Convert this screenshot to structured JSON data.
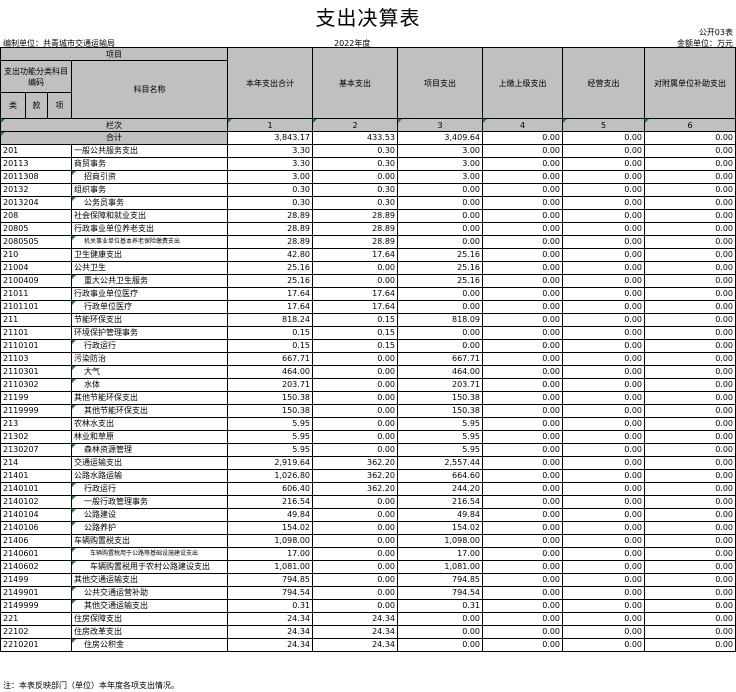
{
  "title": "支出决算表",
  "form_no": "公开03表",
  "org_unit": "编制单位：共青城市交通运输局",
  "year": "2022年度",
  "money_unit": "金额单位：万元",
  "headers": {
    "project": "项目",
    "func_class": "支出功能分类科目编码",
    "subject_name": "科目名称",
    "total": "本年支出合计",
    "basic": "基本支出",
    "project_exp": "项目支出",
    "upper_pay": "上缴上级支出",
    "operation": "经营支出",
    "subsidy": "对附属单位补助支出",
    "lei": "类",
    "kuan": "款",
    "xiang": "项",
    "col_label": "栏次",
    "col_nums": [
      "1",
      "2",
      "3",
      "4",
      "5",
      "6"
    ]
  },
  "total_row": {
    "label": "合计",
    "values": [
      "3,843.17",
      "433.53",
      "3,409.64",
      "0.00",
      "0.00",
      "0.00"
    ]
  },
  "rows": [
    {
      "code": "201",
      "name": "一般公共服务支出",
      "level": 0,
      "values": [
        "3.30",
        "0.30",
        "3.00",
        "0.00",
        "0.00",
        "0.00"
      ]
    },
    {
      "code": "20113",
      "name": "商贸事务",
      "level": 0,
      "values": [
        "3.30",
        "0.30",
        "3.00",
        "0.00",
        "0.00",
        "0.00"
      ]
    },
    {
      "code": "2011308",
      "name": "招商引资",
      "level": 1,
      "values": [
        "3.00",
        "0.00",
        "3.00",
        "0.00",
        "0.00",
        "0.00"
      ]
    },
    {
      "code": "20132",
      "name": "组织事务",
      "level": 0,
      "values": [
        "0.30",
        "0.30",
        "0.00",
        "0.00",
        "0.00",
        "0.00"
      ]
    },
    {
      "code": "2013204",
      "name": "公务员事务",
      "level": 1,
      "values": [
        "0.30",
        "0.30",
        "0.00",
        "0.00",
        "0.00",
        "0.00"
      ]
    },
    {
      "code": "208",
      "name": "社会保障和就业支出",
      "level": 0,
      "values": [
        "28.89",
        "28.89",
        "0.00",
        "0.00",
        "0.00",
        "0.00"
      ]
    },
    {
      "code": "20805",
      "name": "行政事业单位养老支出",
      "level": 0,
      "values": [
        "28.89",
        "28.89",
        "0.00",
        "0.00",
        "0.00",
        "0.00"
      ]
    },
    {
      "code": "2080505",
      "name": "机关事业单位基本养老保险缴费支出",
      "level": 1,
      "small": true,
      "values": [
        "28.89",
        "28.89",
        "0.00",
        "0.00",
        "0.00",
        "0.00"
      ]
    },
    {
      "code": "210",
      "name": "卫生健康支出",
      "level": 0,
      "values": [
        "42.80",
        "17.64",
        "25.16",
        "0.00",
        "0.00",
        "0.00"
      ]
    },
    {
      "code": "21004",
      "name": "公共卫生",
      "level": 0,
      "values": [
        "25.16",
        "0.00",
        "25.16",
        "0.00",
        "0.00",
        "0.00"
      ]
    },
    {
      "code": "2100409",
      "name": "重大公共卫生服务",
      "level": 1,
      "values": [
        "25.16",
        "0.00",
        "25.16",
        "0.00",
        "0.00",
        "0.00"
      ]
    },
    {
      "code": "21011",
      "name": "行政事业单位医疗",
      "level": 0,
      "values": [
        "17.64",
        "17.64",
        "0.00",
        "0.00",
        "0.00",
        "0.00"
      ]
    },
    {
      "code": "2101101",
      "name": "行政单位医疗",
      "level": 1,
      "values": [
        "17.64",
        "17.64",
        "0.00",
        "0.00",
        "0.00",
        "0.00"
      ]
    },
    {
      "code": "211",
      "name": "节能环保支出",
      "level": 0,
      "values": [
        "818.24",
        "0.15",
        "818.09",
        "0.00",
        "0.00",
        "0.00"
      ]
    },
    {
      "code": "21101",
      "name": "环境保护管理事务",
      "level": 0,
      "values": [
        "0.15",
        "0.15",
        "0.00",
        "0.00",
        "0.00",
        "0.00"
      ]
    },
    {
      "code": "2110101",
      "name": "行政运行",
      "level": 1,
      "values": [
        "0.15",
        "0.15",
        "0.00",
        "0.00",
        "0.00",
        "0.00"
      ]
    },
    {
      "code": "21103",
      "name": "污染防治",
      "level": 0,
      "values": [
        "667.71",
        "0.00",
        "667.71",
        "0.00",
        "0.00",
        "0.00"
      ]
    },
    {
      "code": "2110301",
      "name": "大气",
      "level": 1,
      "values": [
        "464.00",
        "0.00",
        "464.00",
        "0.00",
        "0.00",
        "0.00"
      ]
    },
    {
      "code": "2110302",
      "name": "水体",
      "level": 1,
      "values": [
        "203.71",
        "0.00",
        "203.71",
        "0.00",
        "0.00",
        "0.00"
      ]
    },
    {
      "code": "21199",
      "name": "其他节能环保支出",
      "level": 0,
      "values": [
        "150.38",
        "0.00",
        "150.38",
        "0.00",
        "0.00",
        "0.00"
      ]
    },
    {
      "code": "2119999",
      "name": "其他节能环保支出",
      "level": 1,
      "values": [
        "150.38",
        "0.00",
        "150.38",
        "0.00",
        "0.00",
        "0.00"
      ]
    },
    {
      "code": "213",
      "name": "农林水支出",
      "level": 0,
      "values": [
        "5.95",
        "0.00",
        "5.95",
        "0.00",
        "0.00",
        "0.00"
      ]
    },
    {
      "code": "21302",
      "name": "林业和草原",
      "level": 0,
      "values": [
        "5.95",
        "0.00",
        "5.95",
        "0.00",
        "0.00",
        "0.00"
      ]
    },
    {
      "code": "2130207",
      "name": "森林资源管理",
      "level": 1,
      "values": [
        "5.95",
        "0.00",
        "5.95",
        "0.00",
        "0.00",
        "0.00"
      ]
    },
    {
      "code": "214",
      "name": "交通运输支出",
      "level": 0,
      "values": [
        "2,919.64",
        "362.20",
        "2,557.44",
        "0.00",
        "0.00",
        "0.00"
      ]
    },
    {
      "code": "21401",
      "name": "公路水路运输",
      "level": 0,
      "values": [
        "1,026.80",
        "362.20",
        "664.60",
        "0.00",
        "0.00",
        "0.00"
      ]
    },
    {
      "code": "2140101",
      "name": "行政运行",
      "level": 1,
      "values": [
        "606.40",
        "362.20",
        "244.20",
        "0.00",
        "0.00",
        "0.00"
      ]
    },
    {
      "code": "2140102",
      "name": "一般行政管理事务",
      "level": 1,
      "values": [
        "216.54",
        "0.00",
        "216.54",
        "0.00",
        "0.00",
        "0.00"
      ]
    },
    {
      "code": "2140104",
      "name": "公路建设",
      "level": 1,
      "values": [
        "49.84",
        "0.00",
        "49.84",
        "0.00",
        "0.00",
        "0.00"
      ]
    },
    {
      "code": "2140106",
      "name": "公路养护",
      "level": 1,
      "values": [
        "154.02",
        "0.00",
        "154.02",
        "0.00",
        "0.00",
        "0.00"
      ]
    },
    {
      "code": "21406",
      "name": "车辆购置税支出",
      "level": 0,
      "values": [
        "1,098.00",
        "0.00",
        "1,098.00",
        "0.00",
        "0.00",
        "0.00"
      ]
    },
    {
      "code": "2140601",
      "name": "车辆购置税用于公路等基础设施建设支出",
      "level": 2,
      "small": true,
      "values": [
        "17.00",
        "0.00",
        "17.00",
        "0.00",
        "0.00",
        "0.00"
      ]
    },
    {
      "code": "2140602",
      "name": "车辆购置税用于农村公路建设支出",
      "level": 2,
      "values": [
        "1,081.00",
        "0.00",
        "1,081.00",
        "0.00",
        "0.00",
        "0.00"
      ]
    },
    {
      "code": "21499",
      "name": "其他交通运输支出",
      "level": 0,
      "values": [
        "794.85",
        "0.00",
        "794.85",
        "0.00",
        "0.00",
        "0.00"
      ]
    },
    {
      "code": "2149901",
      "name": "公共交通运营补助",
      "level": 1,
      "values": [
        "794.54",
        "0.00",
        "794.54",
        "0.00",
        "0.00",
        "0.00"
      ]
    },
    {
      "code": "2149999",
      "name": "其他交通运输支出",
      "level": 1,
      "values": [
        "0.31",
        "0.00",
        "0.31",
        "0.00",
        "0.00",
        "0.00"
      ]
    },
    {
      "code": "221",
      "name": "住房保障支出",
      "level": 0,
      "values": [
        "24.34",
        "24.34",
        "0.00",
        "0.00",
        "0.00",
        "0.00"
      ]
    },
    {
      "code": "22102",
      "name": "住房改革支出",
      "level": 0,
      "values": [
        "24.34",
        "24.34",
        "0.00",
        "0.00",
        "0.00",
        "0.00"
      ]
    },
    {
      "code": "2210201",
      "name": "住房公积金",
      "level": 1,
      "values": [
        "24.34",
        "24.34",
        "0.00",
        "0.00",
        "0.00",
        "0.00"
      ]
    }
  ],
  "footnote": "注：本表反映部门（单位）本年度各项支出情况。",
  "colors": {
    "header_bg": "#c0c0c0",
    "marker": "#1a8a2a",
    "border": "#000000"
  }
}
